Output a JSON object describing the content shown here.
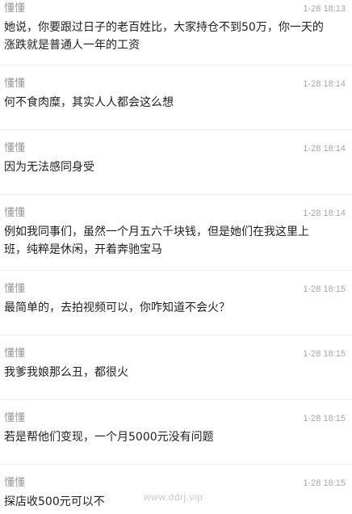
{
  "messages": [
    {
      "sender": "懂懂",
      "time": "1-28 18:13",
      "text": "她说，你要跟过日子的老百姓比，大家持仓不到50万，你一天的涨跌就是普通人一年的工资"
    },
    {
      "sender": "懂懂",
      "time": "1-28 18:14",
      "text": "何不食肉糜，其实人人都会这么想"
    },
    {
      "sender": "懂懂",
      "time": "1-28 18:14",
      "text": "因为无法感同身受"
    },
    {
      "sender": "懂懂",
      "time": "1-28 18:14",
      "text": "例如我同事们，虽然一个月五六千块钱，但是她们在我这里上班，纯粹是休闲，开着奔驰宝马"
    },
    {
      "sender": "懂懂",
      "time": "1-28 18:15",
      "text": "最简单的，去拍视频可以，你咋知道不会火？"
    },
    {
      "sender": "懂懂",
      "time": "1-28 18:15",
      "text": "我爹我娘那么丑，都很火"
    },
    {
      "sender": "懂懂",
      "time": "1-28 18:15",
      "text": "若是帮他们变现，一个月5000元没有问题"
    },
    {
      "sender": "懂懂",
      "time": "1-28 18:15",
      "text": "探店收500元可以不"
    }
  ],
  "watermark": "www.ddrj.vip"
}
